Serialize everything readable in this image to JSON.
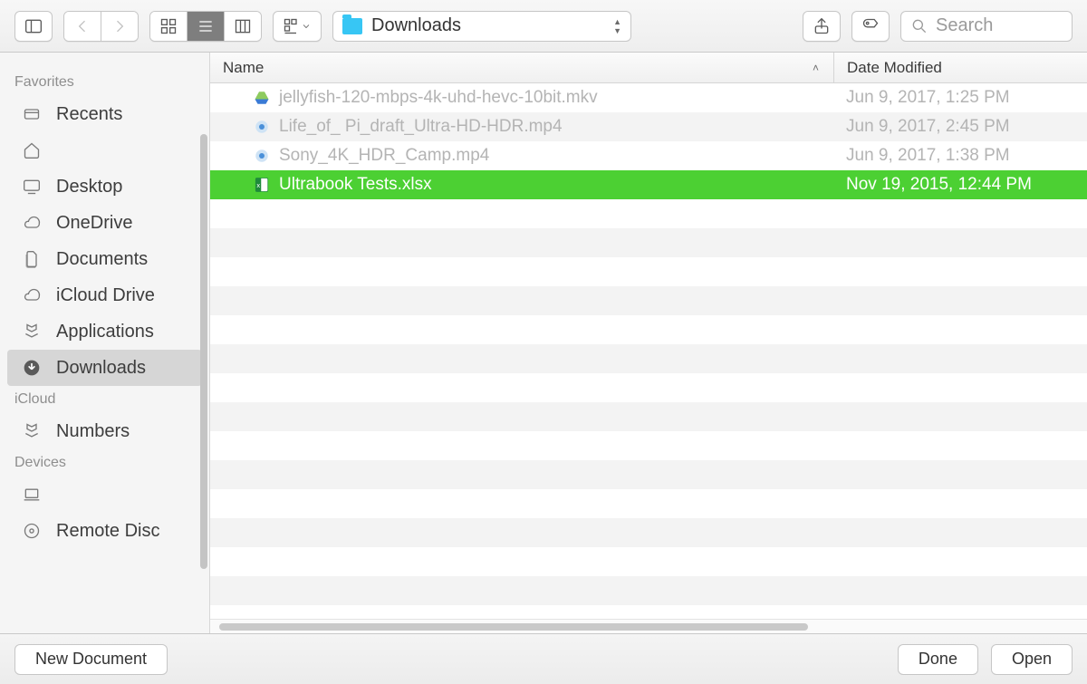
{
  "toolbar": {
    "path_label": "Downloads",
    "search_placeholder": "Search"
  },
  "columns": {
    "name": "Name",
    "modified": "Date Modified"
  },
  "sidebar": {
    "sections": [
      {
        "label": "Favorites",
        "items": [
          {
            "id": "recents",
            "label": "Recents",
            "icon": "recents"
          },
          {
            "id": "home",
            "label": "",
            "icon": "home"
          },
          {
            "id": "desktop",
            "label": "Desktop",
            "icon": "desktop"
          },
          {
            "id": "onedrive",
            "label": "OneDrive",
            "icon": "cloud"
          },
          {
            "id": "documents",
            "label": "Documents",
            "icon": "documents"
          },
          {
            "id": "icloud-drive",
            "label": "iCloud Drive",
            "icon": "cloud"
          },
          {
            "id": "applications",
            "label": "Applications",
            "icon": "applications"
          },
          {
            "id": "downloads",
            "label": "Downloads",
            "icon": "downloads",
            "selected": true
          }
        ]
      },
      {
        "label": "iCloud",
        "items": [
          {
            "id": "numbers",
            "label": "Numbers",
            "icon": "applications"
          }
        ]
      },
      {
        "label": "Devices",
        "items": [
          {
            "id": "laptop",
            "label": "",
            "icon": "laptop"
          },
          {
            "id": "remote-disc",
            "label": "Remote Disc",
            "icon": "disc"
          }
        ]
      }
    ]
  },
  "files": [
    {
      "name": "jellyfish-120-mbps-4k-uhd-hevc-10bit.mkv",
      "modified": "Jun 9, 2017, 1:25 PM",
      "icon": "drive",
      "enabled": false,
      "selected": false
    },
    {
      "name": "Life_of_ Pi_draft_Ultra-HD-HDR.mp4",
      "modified": "Jun 9, 2017, 2:45 PM",
      "icon": "quicktime",
      "enabled": false,
      "selected": false
    },
    {
      "name": "Sony_4K_HDR_Camp.mp4",
      "modified": "Jun 9, 2017, 1:38 PM",
      "icon": "quicktime",
      "enabled": false,
      "selected": false
    },
    {
      "name": "Ultrabook Tests.xlsx",
      "modified": "Nov 19, 2015, 12:44 PM",
      "icon": "xlsx",
      "enabled": true,
      "selected": true
    }
  ],
  "footer": {
    "new_document": "New Document",
    "done": "Done",
    "open": "Open"
  },
  "colors": {
    "selection_green": "#4cd033",
    "folder_blue": "#37c6f4"
  }
}
